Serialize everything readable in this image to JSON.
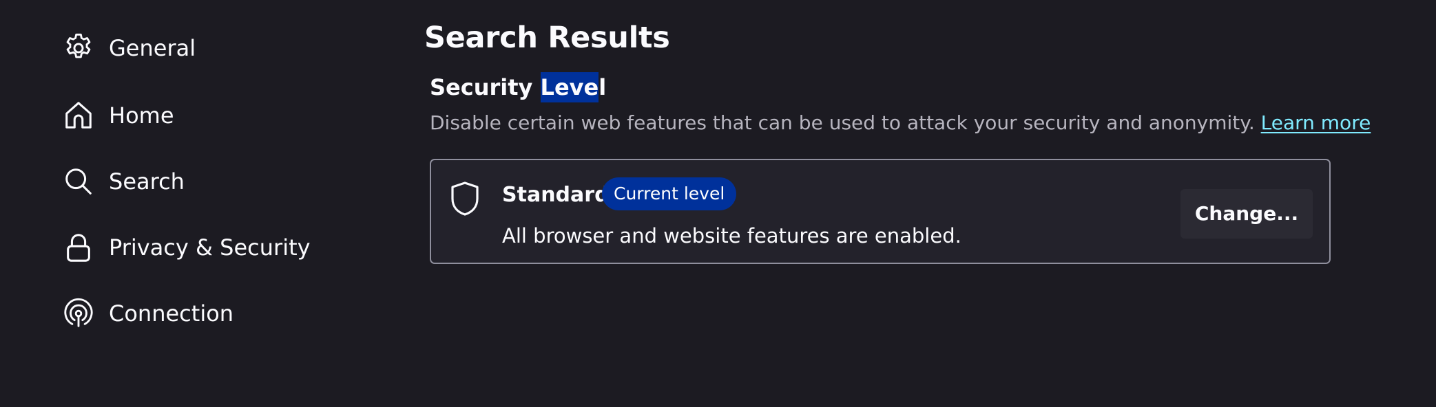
{
  "sidebar": {
    "items": [
      {
        "label": "General",
        "icon": "gear-icon"
      },
      {
        "label": "Home",
        "icon": "home-icon"
      },
      {
        "label": "Search",
        "icon": "search-icon"
      },
      {
        "label": "Privacy & Security",
        "icon": "lock-icon"
      },
      {
        "label": "Connection",
        "icon": "connection-icon"
      }
    ]
  },
  "main": {
    "title": "Search Results",
    "section": {
      "title_prefix": "Security ",
      "title_highlight": "Leve",
      "title_suffix": "l",
      "description": "Disable certain web features that can be used to attack your security and anonymity. ",
      "learn_more": "Learn more"
    },
    "card": {
      "icon": "shield-icon",
      "level_name": "Standard",
      "badge": "Current level",
      "level_description": "All browser and website features are enabled.",
      "change_button": "Change..."
    }
  },
  "colors": {
    "background": "#1c1b22",
    "text": "#fbfbfe",
    "muted_text": "#b7b5bf",
    "link": "#80ebff",
    "highlight": "#00319b",
    "card_border": "#8f8f9d",
    "card_background": "#23222b",
    "button_background": "#2b2a33"
  }
}
